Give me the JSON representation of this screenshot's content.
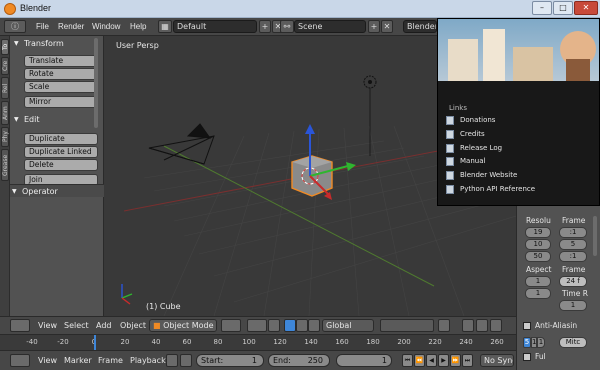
{
  "window": {
    "title": "Blender",
    "btn_min": "–",
    "btn_max": "□",
    "btn_close": "✕"
  },
  "info_header": {
    "menus": [
      "File",
      "Render",
      "Window",
      "Help"
    ],
    "screen_layout": "Default",
    "scene": "Scene",
    "render_engine": "Blender R"
  },
  "tool_tabs": [
    "To",
    "Cre",
    "Rel",
    "Anm",
    "Phy",
    "Grease"
  ],
  "tool_shelf": {
    "transform_title": "Transform",
    "transform_buttons": [
      "Translate",
      "Rotate",
      "Scale",
      "Mirror"
    ],
    "edit_title": "Edit",
    "edit_buttons": [
      "Duplicate",
      "Duplicate Linked",
      "Delete",
      "Join"
    ],
    "operator_title": "Operator"
  },
  "viewport": {
    "label": "User Persp",
    "object_label": "(1) Cube"
  },
  "splash": {
    "links_title": "Links",
    "links": [
      "Donations",
      "Credits",
      "Release Log",
      "Manual",
      "Blender Website",
      "Python API Reference"
    ]
  },
  "properties": {
    "resolution_label": "Resolu",
    "frame_label": "Frame",
    "res_values": [
      "19",
      "10",
      "50"
    ],
    "frame_values": [
      ":1",
      "5",
      ":1"
    ],
    "aspect_label": "Aspect",
    "aspect_values": [
      "1",
      "1"
    ],
    "frame_rate_label": "Frame",
    "frame_rate": "24 f",
    "time_label": "Time R",
    "time_value": "1",
    "anti_alias_label": "Anti-Aliasin",
    "aa_samples": [
      "5",
      "8",
      "1",
      "1"
    ],
    "aa_filter": "Mitc",
    "full_label": "Ful"
  },
  "view_header": {
    "menus": [
      "View",
      "Select",
      "Add",
      "Object"
    ],
    "mode": "Object Mode",
    "orientation": "Global"
  },
  "timeline": {
    "ticks": [
      "-40",
      "-20",
      "0",
      "20",
      "40",
      "60",
      "80",
      "100",
      "120",
      "140",
      "160",
      "180",
      "200",
      "220",
      "240",
      "260"
    ],
    "current_frame_fraction": 0.0
  },
  "bottom_bar": {
    "menus": [
      "View",
      "Marker",
      "Frame",
      "Playback"
    ],
    "start_label": "Start:",
    "start_value": "1",
    "end_label": "End:",
    "end_value": "250",
    "current_frame": "1",
    "sync": "No Sync"
  }
}
